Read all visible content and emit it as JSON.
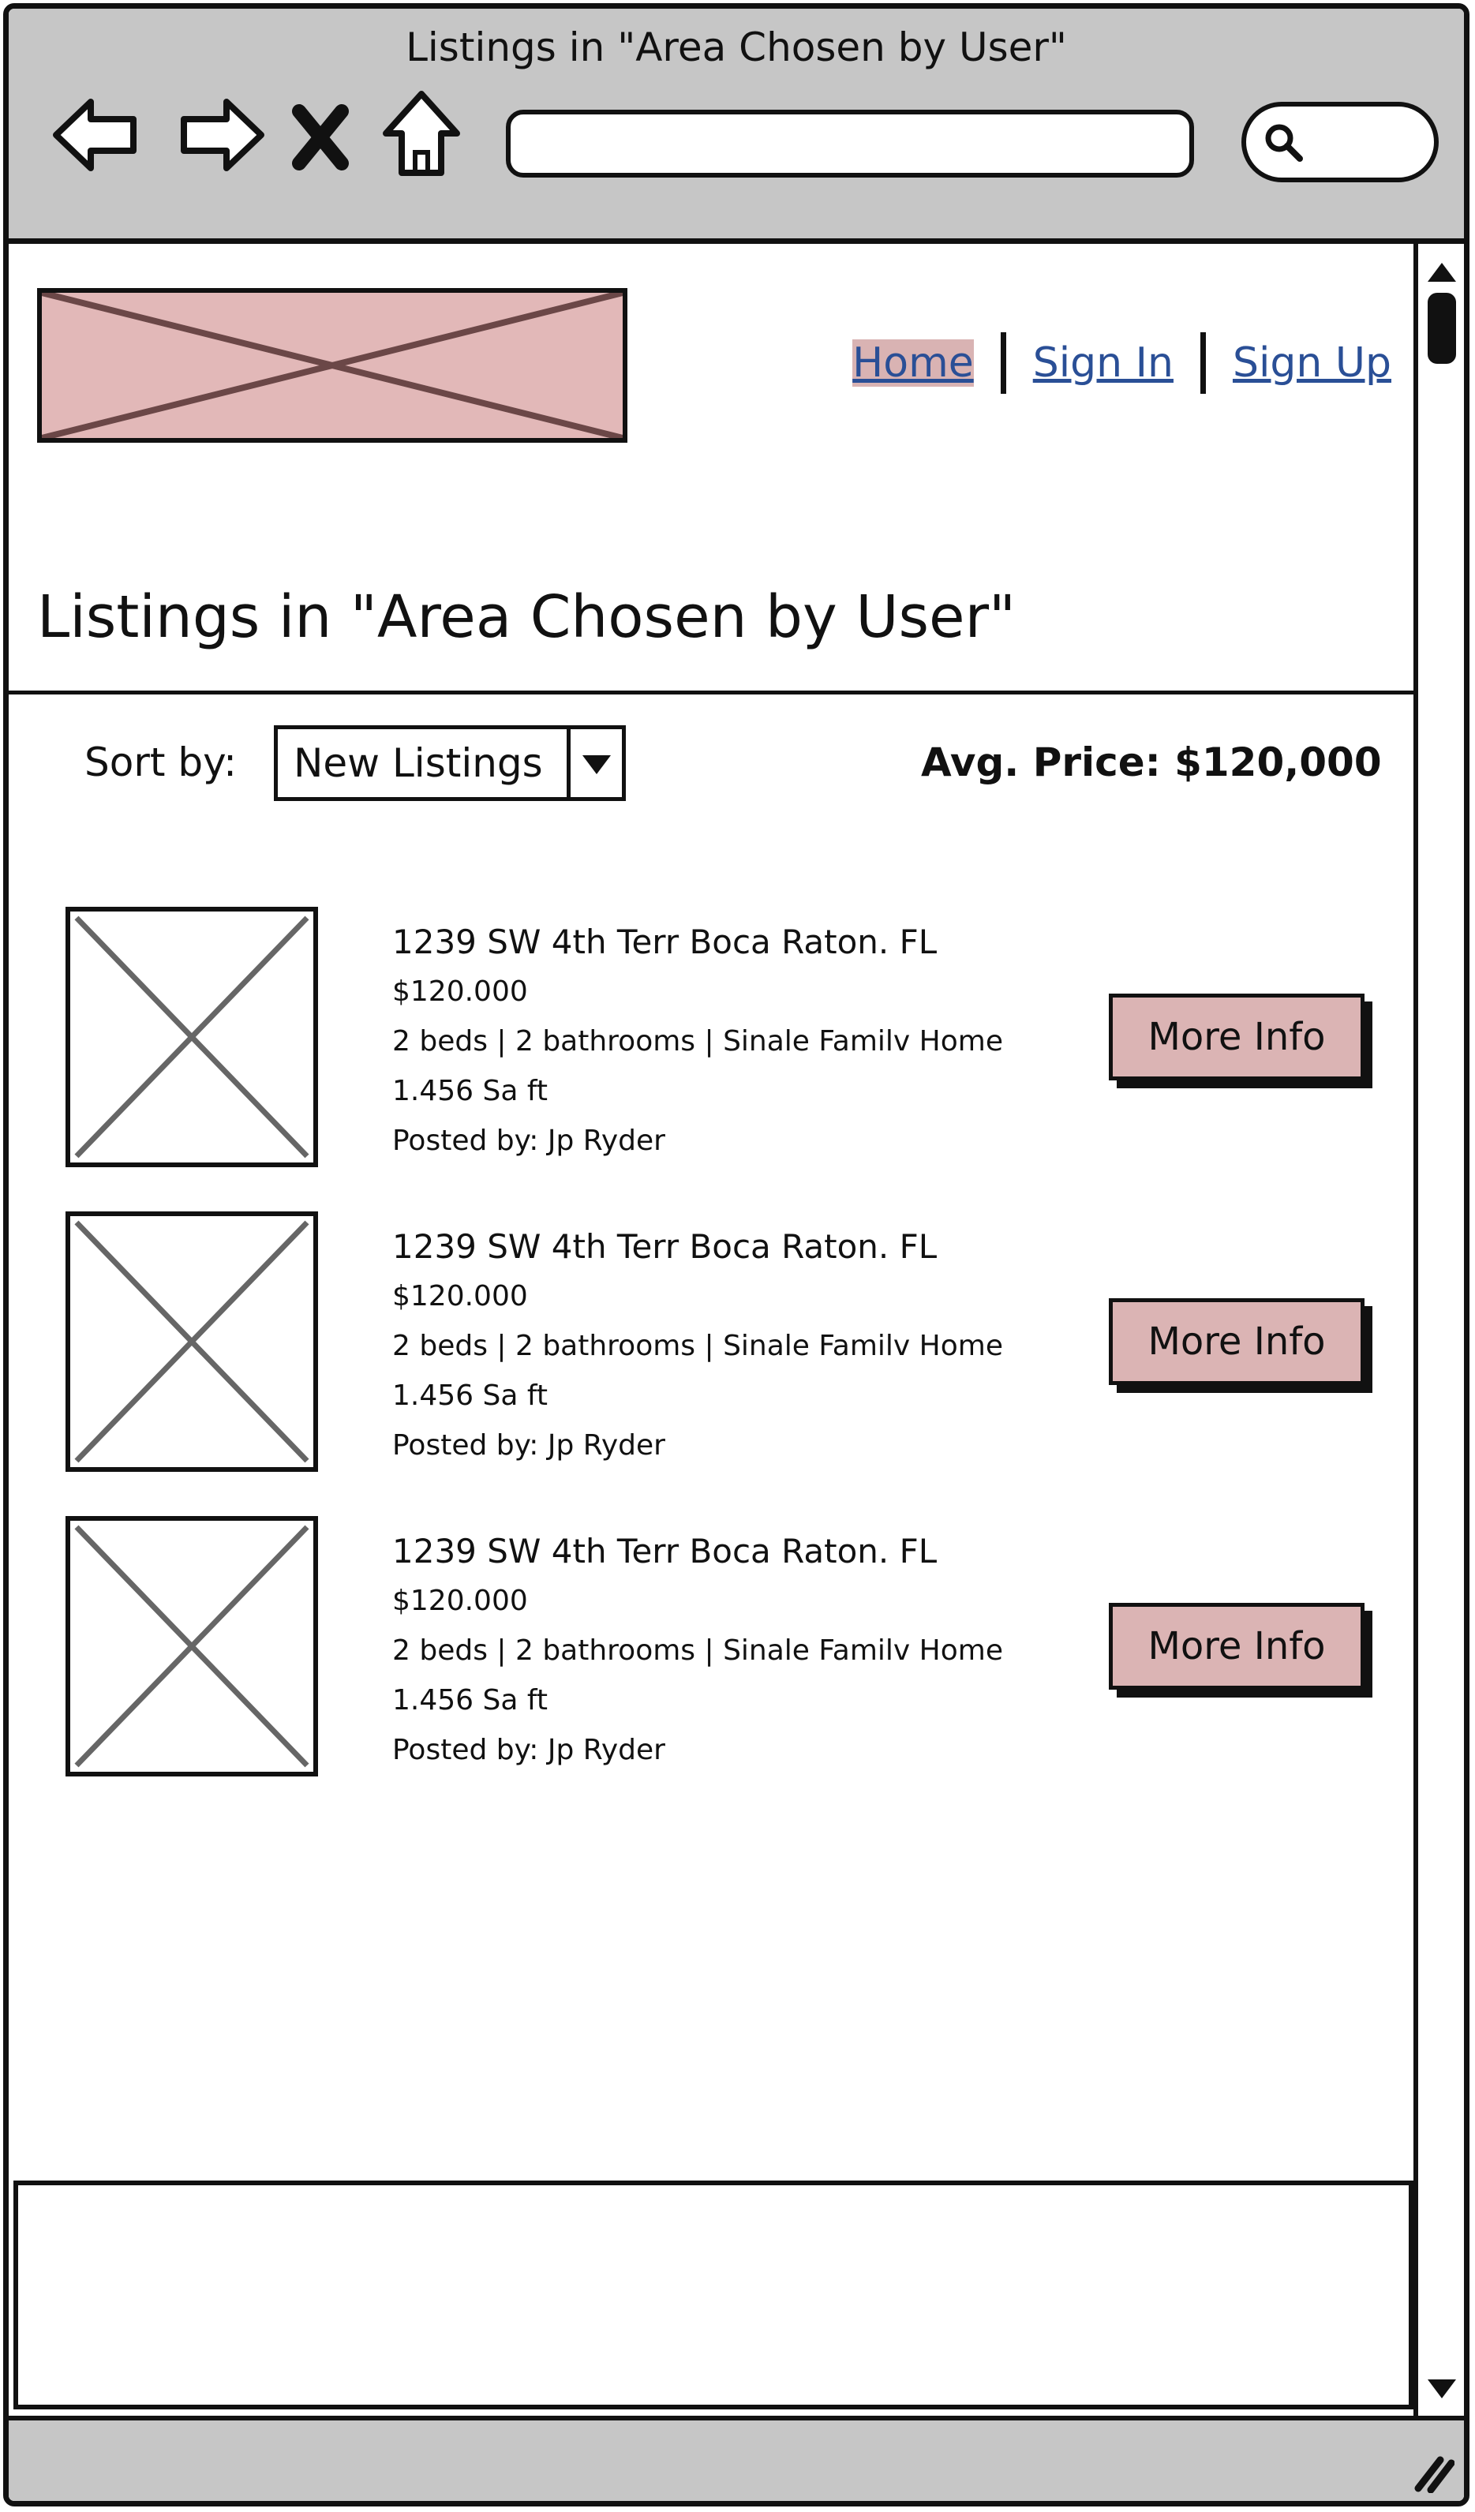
{
  "window": {
    "title": "Listings in \"Area Chosen by User\""
  },
  "browser": {
    "back_icon": "back-arrow-icon",
    "forward_icon": "forward-arrow-icon",
    "stop_icon": "close-icon",
    "home_icon": "home-icon",
    "search_icon": "search-icon",
    "url_value": ""
  },
  "header": {
    "nav": {
      "home": "Home",
      "sign_in": "Sign In",
      "sign_up": "Sign Up"
    }
  },
  "main": {
    "title": "Listings in \"Area Chosen by User\"",
    "sort": {
      "label": "Sort by:",
      "selected": "New Listings"
    },
    "avg_price": "Avg. Price: $120,000",
    "listings": [
      {
        "address": "1239 SW 4th Terr Boca Raton. FL",
        "price": "$120.000",
        "details": "2 beds | 2 bathrooms | Sinale Familv Home",
        "size": "1.456 Sa ft",
        "posted_by": "Posted by: Jp Ryder",
        "button": "More Info"
      },
      {
        "address": "1239 SW 4th Terr Boca Raton. FL",
        "price": "$120.000",
        "details": "2 beds | 2 bathrooms | Sinale Familv Home",
        "size": "1.456 Sa ft",
        "posted_by": "Posted by: Jp Ryder",
        "button": "More Info"
      },
      {
        "address": "1239 SW 4th Terr Boca Raton. FL",
        "price": "$120.000",
        "details": "2 beds | 2 bathrooms | Sinale Familv Home",
        "size": "1.456 Sa ft",
        "posted_by": "Posted by: Jp Ryder",
        "button": "More Info"
      }
    ]
  },
  "colors": {
    "chrome": "#c6c6c6",
    "logo_fill": "#e2b8b8",
    "button_fill": "#dbb4b4",
    "link": "#2a4f96",
    "active_link_bg": "#d9b3b3"
  }
}
